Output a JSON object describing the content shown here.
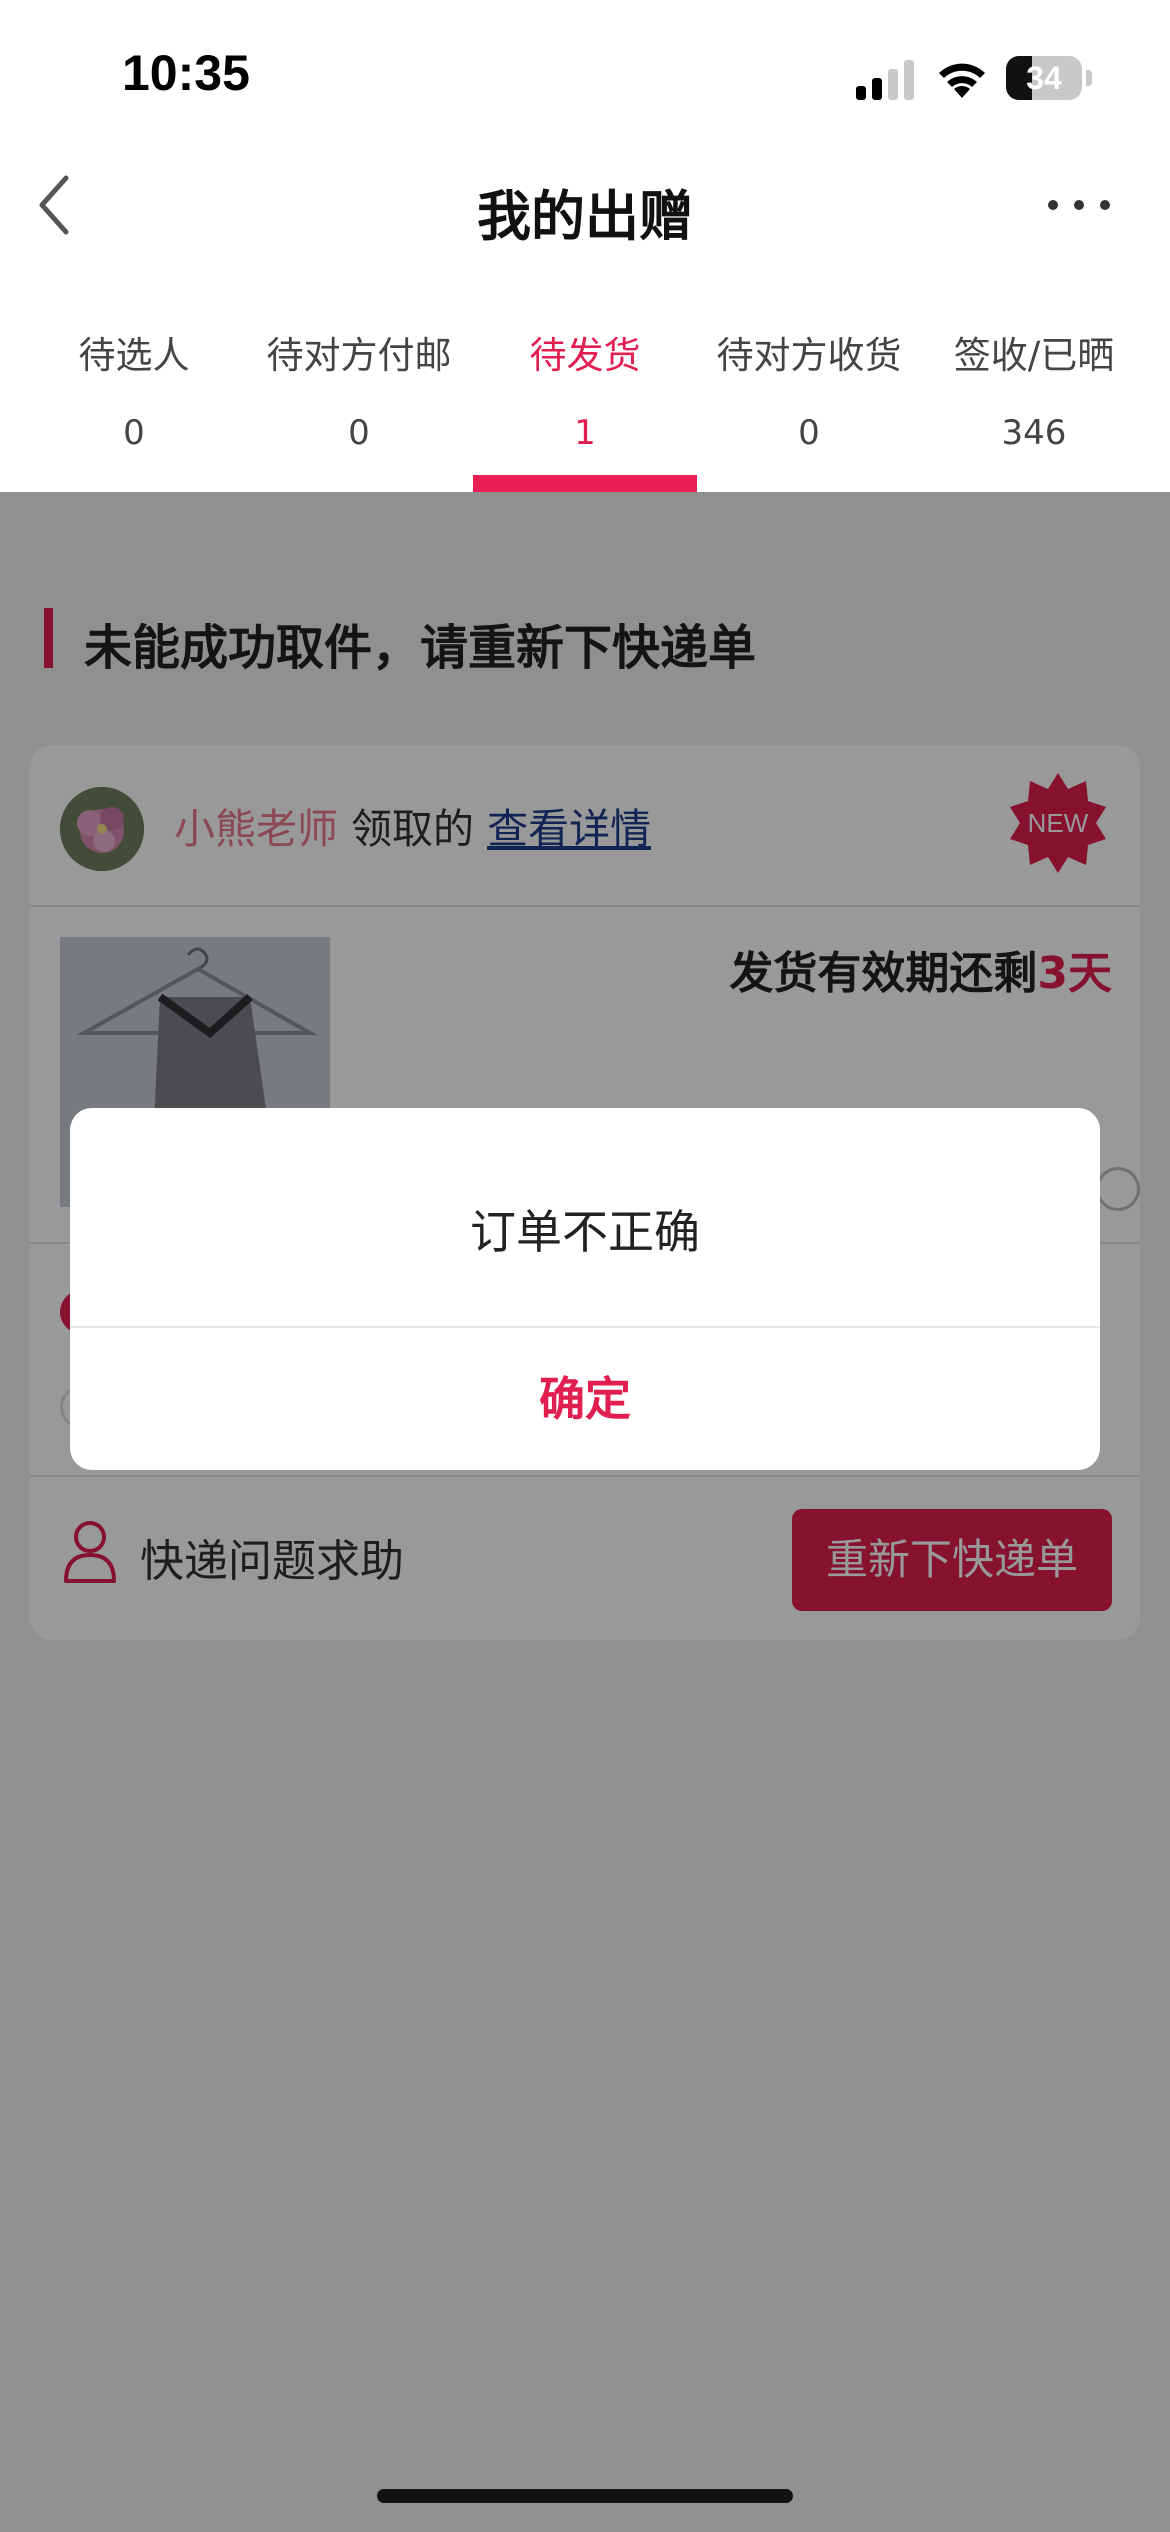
{
  "status_bar": {
    "time": "10:35",
    "battery": "34",
    "battery_fraction": 0.34,
    "signal_bars": 2
  },
  "header": {
    "title": "我的出赠",
    "back_icon": "chevron-left-icon",
    "more_icon": "ellipsis-icon"
  },
  "tabs": [
    {
      "label": "待选人",
      "count": "0"
    },
    {
      "label": "待对方付邮",
      "count": "0"
    },
    {
      "label": "待发货",
      "count": "1",
      "active": true
    },
    {
      "label": "待对方收货",
      "count": "0"
    },
    {
      "label": "签收/已晒",
      "count": "346"
    }
  ],
  "section": {
    "title": "未能成功取件，请重新下快递单"
  },
  "order_card": {
    "claimer": "小熊老师",
    "claim_text": "领取的",
    "detail_link": "查看详情",
    "new_badge": "NEW",
    "deadline_prefix": "发货有效期还剩",
    "deadline_days": "3天",
    "help_text": "快递问题求助",
    "help_icon": "person-outline-icon",
    "reorder_button": "重新下快递单"
  },
  "dialog": {
    "message": "订单不正确",
    "confirm": "确定"
  },
  "colors": {
    "accent": "#e01e50",
    "claimer": "#e87a8c",
    "link": "#1e3c8c"
  }
}
